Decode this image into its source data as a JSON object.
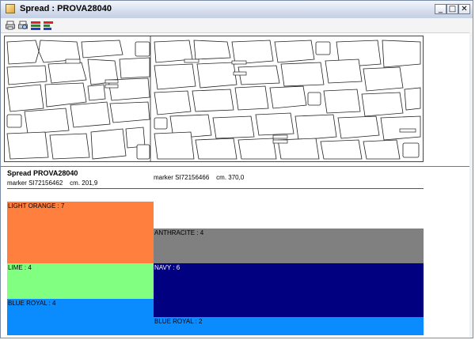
{
  "window": {
    "title": "Spread : PROVA28040",
    "controls": {
      "minimize": "_",
      "maximize": "□",
      "close": "✕"
    }
  },
  "toolbar": {
    "icons": [
      "print-icon",
      "print-preview-icon",
      "color-bars-icon",
      "color-legend-icon"
    ]
  },
  "spread": {
    "title": "Spread PROVA28040",
    "markers": [
      {
        "label": "marker SI72156462    cm. 201,9"
      },
      {
        "label": "marker SI72156466    cm. 370,0"
      }
    ]
  },
  "colors": {
    "light_orange": "#ff7f3f",
    "anthracite": "#808080",
    "lime": "#80ff80",
    "navy": "#000080",
    "blue_royal": "#0a8cff"
  },
  "layers": [
    {
      "label": "LIGHT ORANGE : 7"
    },
    {
      "label": "ANTHRACITE : 4"
    },
    {
      "label": "LIME : 4"
    },
    {
      "label": "NAVY : 6"
    },
    {
      "label": "BLUE ROYAL : 4"
    },
    {
      "label": "BLUE ROYAL : 2"
    }
  ]
}
